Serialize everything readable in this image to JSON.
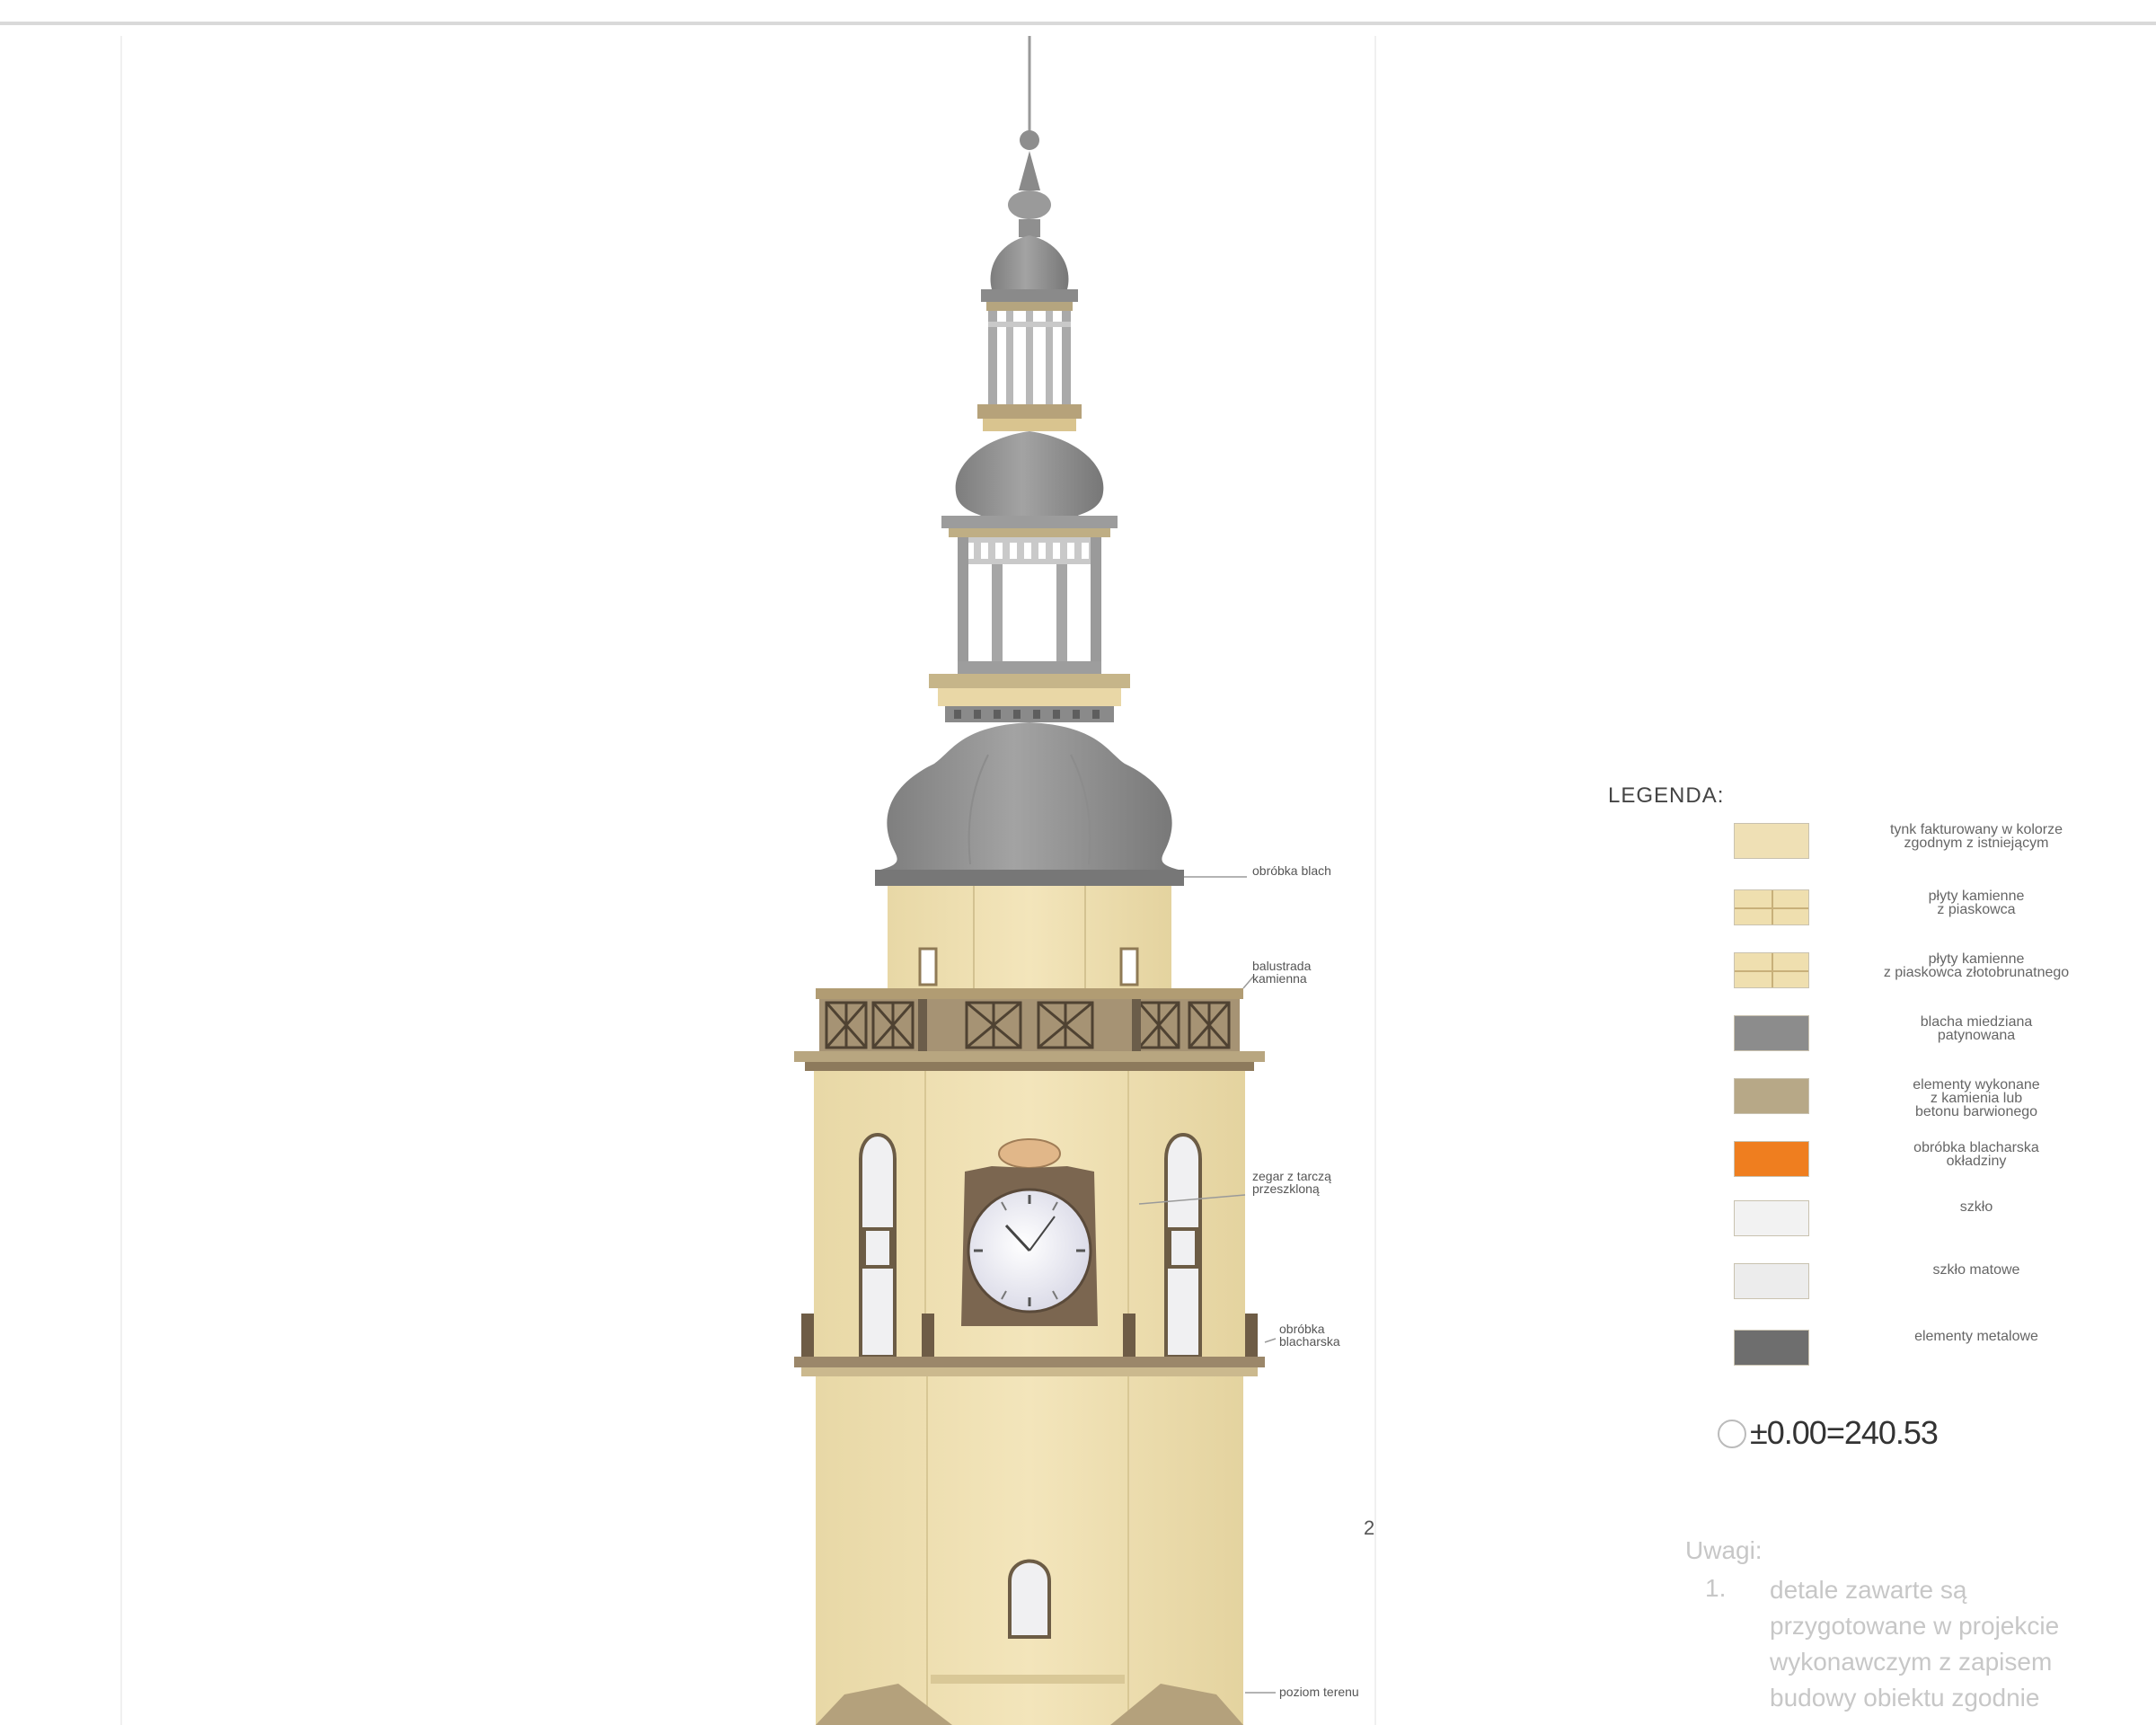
{
  "legend": {
    "title": "LEGENDA:",
    "items": [
      {
        "swatch_color": "#efe0b5",
        "gridded": false,
        "label": "tynk fakturowany w kolorze\nzgodnym z istniejącym"
      },
      {
        "swatch_color": "#efdfaf",
        "gridded": true,
        "label": "płyty kamienne\nz piaskowca"
      },
      {
        "swatch_color": "#efdfaf",
        "gridded": true,
        "label": "płyty kamienne\nz piaskowca złotobrunatnego"
      },
      {
        "swatch_color": "#8c8c8c",
        "gridded": false,
        "label": "blacha miedziana\npatynowana"
      },
      {
        "swatch_color": "#b7a887",
        "gridded": false,
        "label": "elementy wykonane\nz kamienia lub\nbetonu barwionego"
      },
      {
        "swatch_color": "#ef7e1f",
        "gridded": false,
        "label": "obróbka blacharska\nokładziny"
      },
      {
        "swatch_color": "#f2f2f2",
        "gridded": false,
        "label": "szkło"
      },
      {
        "swatch_color": "#ececec",
        "gridded": false,
        "label": "szkło matowe"
      },
      {
        "swatch_color": "#6e6e6e",
        "gridded": false,
        "label": "elementy metalowe"
      }
    ]
  },
  "datum": "±0.00=240.53",
  "notes": {
    "heading": "Uwagi:",
    "number": "1.",
    "text": "detale zawarte są\nprzygotowane w projekcie\nwykonawczym z zapisem\nbudowy obiektu zgodnie"
  },
  "callouts": [
    {
      "text": "obróbka blach"
    },
    {
      "text": "balustrada\nkamienna"
    },
    {
      "text": "zegar z tarczą\nprzeszkloną"
    },
    {
      "text": "obróbka\nblacharska"
    },
    {
      "text": "poziom terenu"
    }
  ],
  "edge_mark": "2"
}
